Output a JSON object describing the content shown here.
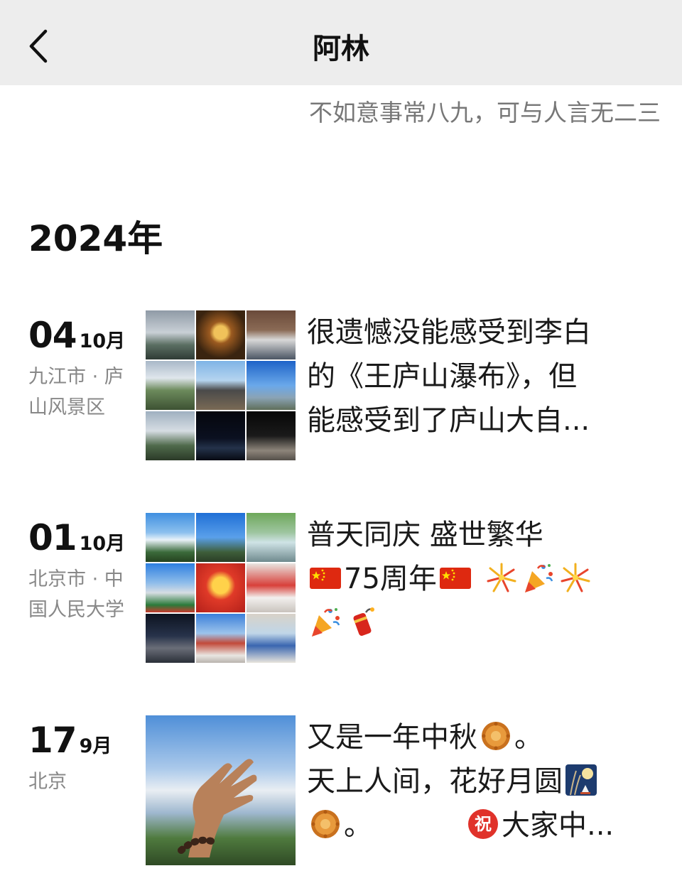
{
  "header": {
    "title": "阿林"
  },
  "profile": {
    "signature": "不如意事常八九，可与人言无二三"
  },
  "timeline": {
    "year": "2024年",
    "posts": [
      {
        "day": "04",
        "month": "10月",
        "location": "九江市 · 庐山风景区",
        "text_lines": [
          "很遗憾没能感受到李白",
          "的《王庐山瀑布》，但",
          "能感受到了庐山大自..."
        ]
      },
      {
        "day": "01",
        "month": "10月",
        "location": "北京市 · 中国人民大学",
        "text_line1": "普天同庆 盛世繁华",
        "text_line2": "75周年"
      },
      {
        "day": "17",
        "month": "9月",
        "location": "北京",
        "text_line1": "又是一年中秋",
        "text_line1_tail": "。",
        "text_line2": "天上人间，花好月圆",
        "text_line3_a": "。",
        "text_line3_b": "大家中..."
      }
    ]
  },
  "icons": {
    "back": "chevron-left-icon",
    "emojis": [
      "china-flag-icon",
      "fireworks-icon",
      "party-popper-icon",
      "firecracker-icon",
      "mooncake-icon",
      "moon-viewing-icon",
      "congratulations-icon"
    ]
  },
  "colors": {
    "header_bg": "#ededed",
    "secondary_text": "#888888",
    "signature_text": "#777777"
  }
}
